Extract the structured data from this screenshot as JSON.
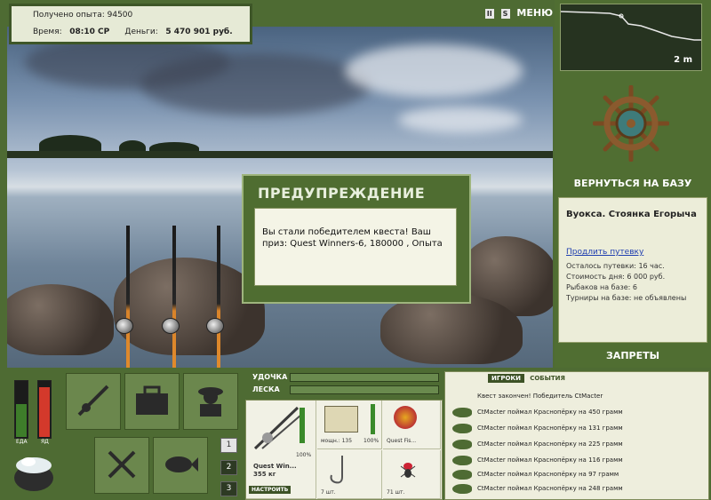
{
  "status": {
    "exp_label": "Получено опыта:",
    "exp_value": "94500",
    "time_label": "Время:",
    "time_value": "08:10 СР",
    "money_label": "Деньги:",
    "money_value": "5 470 901 руб."
  },
  "topbar": {
    "pause": "II",
    "sound": "S",
    "menu": "МЕНЮ"
  },
  "depth": {
    "value": "2 m"
  },
  "right_panel": {
    "return_label": "ВЕРНУТЬСЯ НА БАЗУ",
    "location": "Вуокса. Стоянка Егорыча",
    "extend_link": "Продлить путевку",
    "lines": [
      "Осталось путевки: 16 час.",
      "Стоимость дня: 6 000 руб.",
      "Рыбаков на базе: 6",
      "Турниры на базе: не объявлены"
    ],
    "bans_label": "ЗАПРЕТЫ"
  },
  "dialog": {
    "title": "ПРЕДУПРЕЖДЕНИЕ",
    "message": "Вы стали победителем квеста! Ваш приз: Quest Winners-6, 180000 , Опыта"
  },
  "meters": {
    "food_label": "ЕДА",
    "health_label": "ЯД",
    "food_level": 0.6,
    "health_level": 0.9,
    "food_color": "#3e7d2a",
    "health_color": "#d3392b"
  },
  "slots": [
    "1",
    "2",
    "3"
  ],
  "rod_line": {
    "rod_label": "УДОЧКА",
    "line_label": "ЛЕСКА"
  },
  "gear": {
    "rod_name": "Quest Win...",
    "rod_weight": "355 кг",
    "rod_percent": "100%",
    "setup_button": "НАСТРОИТЬ",
    "reel_label": "мощн.: 135",
    "reel_percent": "100%",
    "lure_name": "Quest Fis...",
    "hook_count": "7 шт.",
    "bait_count": "71 шт."
  },
  "events": {
    "tabs": [
      "ИГРОКИ",
      "СОБЫТИЯ"
    ],
    "items": [
      "Квест закончен! Победитель CtMacter",
      "CtMacter поймал Краснопёрку на 450 грамм",
      "CtMacter поймал Краснопёрку на 131 грамм",
      "CtMacter поймал Краснопёрку на 225 грамм",
      "CtMacter поймал Краснопёрку на 116 грамм",
      "CtMacter поймал Краснопёрку на 97 грамм",
      "CtMacter поймал Краснопёрку на 248 грамм"
    ]
  }
}
